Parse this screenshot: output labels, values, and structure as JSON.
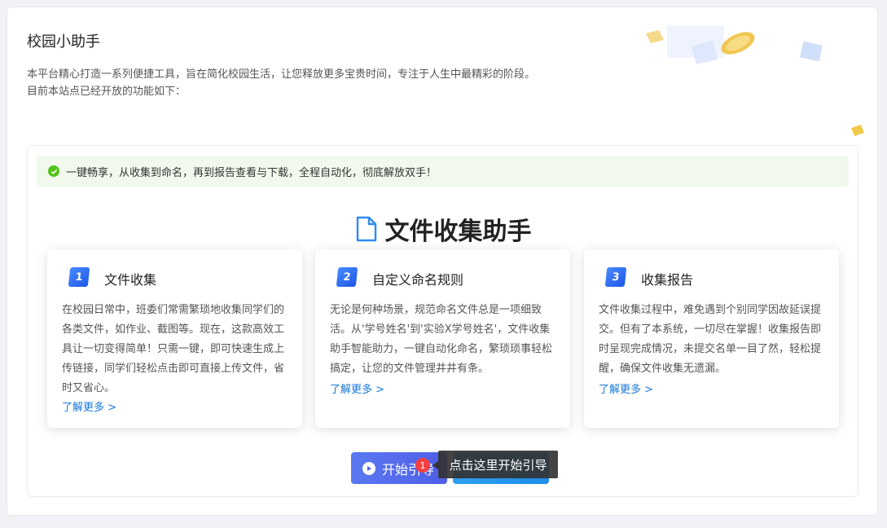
{
  "page": {
    "title": "校园小助手",
    "intro_line1": "本平台精心打造一系列便捷工具，旨在简化校园生活，让您释放更多宝贵时间，专注于人生中最精彩的阶段。",
    "intro_line2": "目前本站点已经开放的功能如下："
  },
  "notice": {
    "text": "一键畅享，从收集到命名，再到报告查看与下载，全程自动化，彻底解放双手！",
    "icon": "check-circle-icon",
    "color": "#52c41a"
  },
  "section": {
    "heading": "文件收集助手",
    "icon": "document-icon",
    "accent": "#2d8cf0"
  },
  "features": [
    {
      "num": "1",
      "title": "文件收集",
      "desc": "在校园日常中，班委们常需繁琐地收集同学们的各类文件，如作业、截图等。现在，这款高效工具让一切变得简单！只需一键，即可快速生成上传链接，同学们轻松点击即可直接上传文件，省时又省心。",
      "more": "了解更多 >"
    },
    {
      "num": "2",
      "title": "自定义命名规则",
      "desc": "无论是何种场景，规范命名文件总是一项细致活。从'学号姓名'到'实验X学号姓名'，文件收集助手智能助力，一键自动化命名，繁琐琐事轻松搞定，让您的文件管理井井有条。",
      "more": "了解更多 >"
    },
    {
      "num": "3",
      "title": "收集报告",
      "desc": "文件收集过程中，难免遇到个别同学因故延误提交。但有了本系统，一切尽在掌握！收集报告即时呈现完成情况，未提交名单一目了然，轻松提醒，确保文件收集无遗漏。",
      "more": "了解更多 >"
    }
  ],
  "actions": {
    "start_label": "开始引导"
  },
  "guide": {
    "step": "1",
    "tooltip": "点击这里开始引导"
  }
}
